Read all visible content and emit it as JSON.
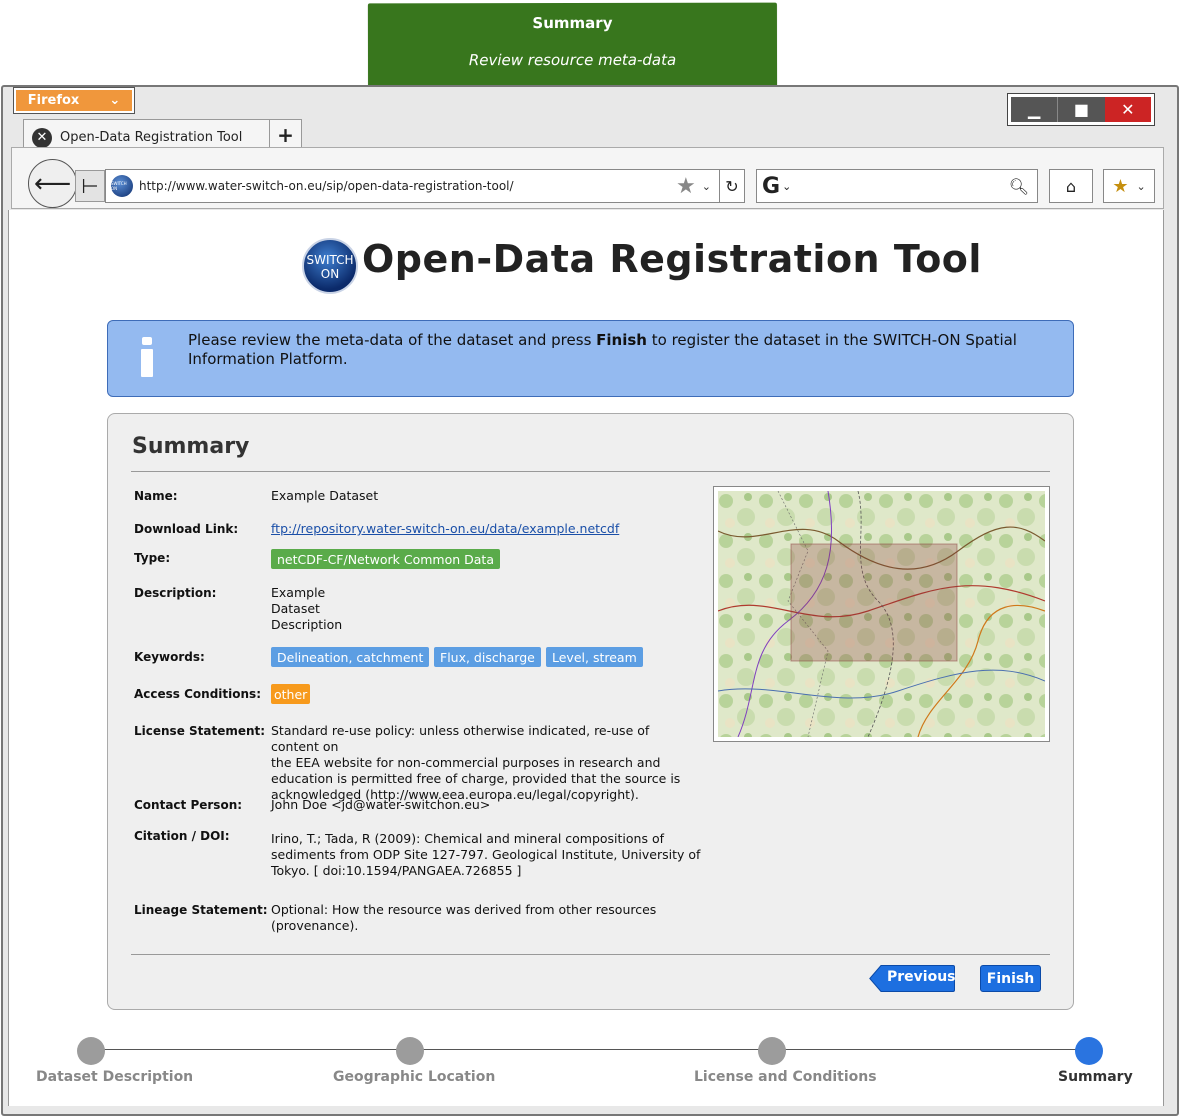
{
  "note": {
    "title": "Summary",
    "subtitle": "Review resource meta-data"
  },
  "browser": {
    "menu_label": "Firefox",
    "tab_title": "Open-Data Registration Tool",
    "new_tab": "+",
    "url": "http://www.water-switch-on.eu/sip/open-data-registration-tool/",
    "search_engine": "G",
    "logo_text": "SWITCH ON"
  },
  "page": {
    "logo_line1": "SWITCH",
    "logo_line2": "ON",
    "title": "Open-Data Registration Tool",
    "info_before": "Please review the meta-data of the dataset and press ",
    "info_bold": "Finish",
    "info_after": " to register the dataset in the SWITCH-ON Spatial Information Platform."
  },
  "summary": {
    "heading": "Summary",
    "fields": {
      "name_label": "Name:",
      "name": "Example Dataset",
      "download_label": "Download Link:",
      "download": "ftp://repository.water-switch-on.eu/data/example.netcdf",
      "type_label": "Type:",
      "type": "netCDF-CF/Network Common Data",
      "description_label": "Description:",
      "description_1": "Example",
      "description_2": "Dataset",
      "description_3": "Description",
      "keywords_label": "Keywords:",
      "keywords": [
        "Delineation, catchment",
        "Flux, discharge",
        "Level, stream"
      ],
      "access_label": "Access Conditions:",
      "access": "other",
      "license_label": "License Statement:",
      "license_1": "Standard re-use policy: unless otherwise indicated, re-use of content on",
      "license_2": "the EEA website for non-commercial purposes in research and",
      "license_3": "education is permitted free of charge, provided that the source is",
      "license_4": "acknowledged (http://www.eea.europa.eu/legal/copyright).",
      "contact_label": "Contact Person:",
      "contact": "John Doe <jd@water-switchon.eu>",
      "citation_label": "Citation / DOI:",
      "citation_1": "Irino, T.; Tada, R (2009): Chemical and mineral compositions of",
      "citation_2": "sediments from ODP Site 127-797. Geological Institute, University of",
      "citation_3": "Tokyo. [ doi:10.1594/PANGAEA.726855 ]",
      "lineage_label": "Lineage Statement:",
      "lineage_1": "Optional: How the resource was derived from other resources",
      "lineage_2": "(provenance)."
    },
    "previous_label": "Previous",
    "finish_label": "Finish"
  },
  "steps": [
    {
      "label": "Dataset Description",
      "active": false
    },
    {
      "label": "Geographic Location",
      "active": false
    },
    {
      "label": "License and Conditions",
      "active": false
    },
    {
      "label": "Summary",
      "active": true
    }
  ],
  "colors": {
    "note": "#38761d",
    "info_bg": "#94baf0",
    "type_tag": "#5aab4a",
    "keyword_tag": "#5c9ee3",
    "access_tag": "#f79a1c",
    "primary_button": "#1d6fe0",
    "step_active": "#2a74e0",
    "step_inactive": "#9c9c9c"
  }
}
